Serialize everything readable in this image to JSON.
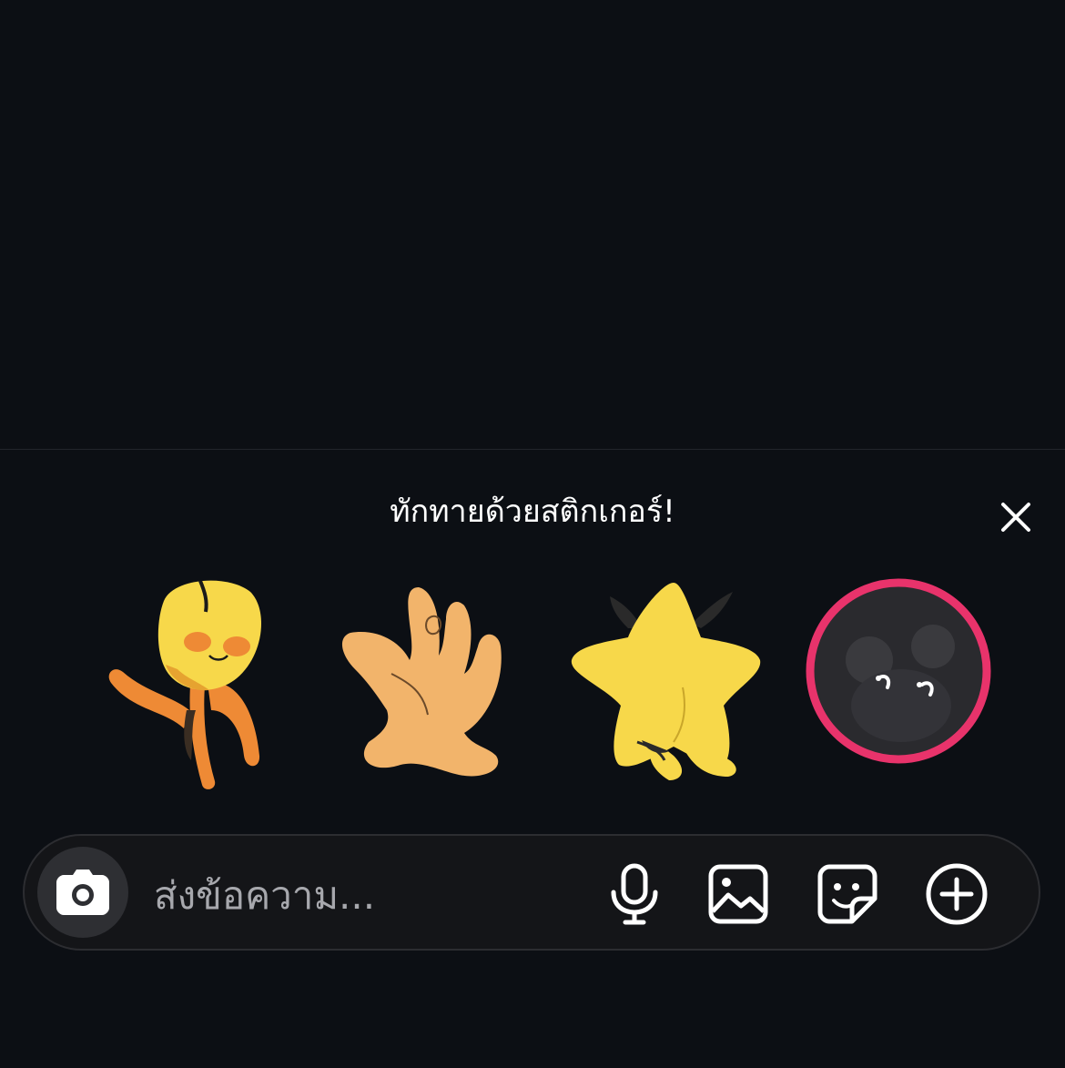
{
  "sticker_panel": {
    "prompt": "ทักทายด้วยสติกเกอร์!",
    "close_icon": "close-icon",
    "stickers": [
      {
        "name": "flower-sticker",
        "description_icon": "yellow-flower-character"
      },
      {
        "name": "waving-hand-sticker",
        "description_icon": "orange-hand-wave"
      },
      {
        "name": "star-sticker",
        "description_icon": "yellow-star-character"
      },
      {
        "name": "avatar-sticker",
        "description_icon": "dark-bear-peek",
        "ring_color": "#e8336b"
      }
    ]
  },
  "composer": {
    "placeholder": "ส่งข้อความ...",
    "camera_icon": "camera-icon",
    "mic_icon": "microphone-icon",
    "gallery_icon": "image-icon",
    "sticker_icon": "sticker-icon",
    "add_icon": "plus-circle-icon"
  },
  "colors": {
    "background": "#0c0f14",
    "composer_bg": "#141518",
    "camera_bg": "#2e2f33",
    "accent_ring": "#e8336b",
    "sticker_yellow": "#f7d84a",
    "sticker_orange": "#ee8a35",
    "sticker_peach": "#f2b46b"
  }
}
